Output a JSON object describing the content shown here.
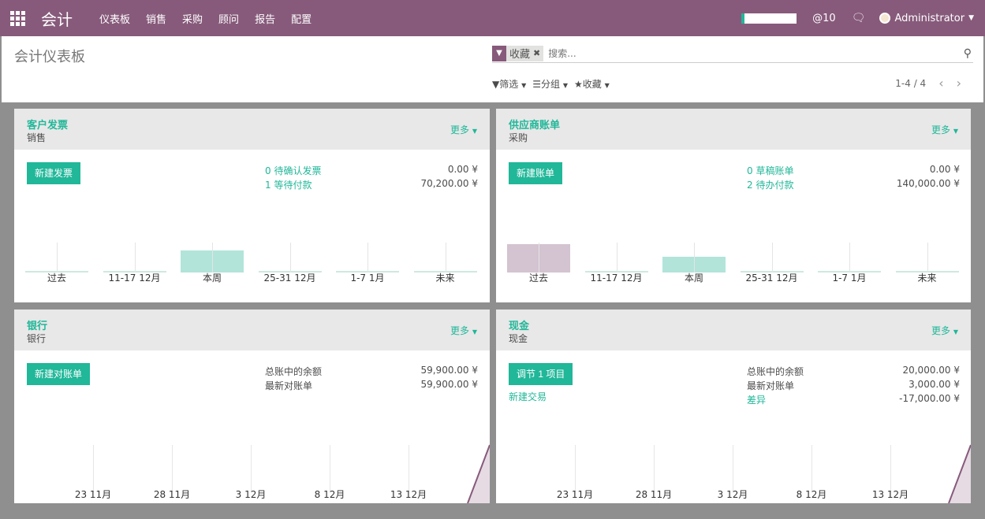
{
  "navbar": {
    "brand": "会计",
    "menu": [
      "仪表板",
      "销售",
      "采购",
      "顾问",
      "报告",
      "配置"
    ],
    "mentions": "@10",
    "user": "Administrator"
  },
  "control": {
    "title": "会计仪表板",
    "facet": "收藏",
    "search_placeholder": "搜索...",
    "filter_label": "筛选",
    "group_label": "分组",
    "fav_label": "收藏",
    "pager": "1-4 / 4"
  },
  "cards": {
    "sales": {
      "title": "客户发票",
      "subtitle": "销售",
      "more": "更多",
      "button": "新建发票",
      "stats": [
        {
          "label": "0 待确认发票",
          "value": "0.00 ¥"
        },
        {
          "label": "1 等待付款",
          "value": "70,200.00 ¥"
        }
      ],
      "bar_labels": [
        "过去",
        "11-17 12月",
        "本周",
        "25-31 12月",
        "1-7 1月",
        "未来"
      ],
      "bar_values": [
        0,
        0,
        70200,
        0,
        0,
        0
      ]
    },
    "purchase": {
      "title": "供应商账单",
      "subtitle": "采购",
      "more": "更多",
      "button": "新建账单",
      "stats": [
        {
          "label": "0 草稿账单",
          "value": "0.00 ¥"
        },
        {
          "label": "2 待办付款",
          "value": "140,000.00 ¥"
        }
      ],
      "bar_labels": [
        "过去",
        "11-17 12月",
        "本周",
        "25-31 12月",
        "1-7 1月",
        "未来"
      ],
      "bar_values": [
        90000,
        0,
        50000,
        0,
        0,
        0
      ]
    },
    "bank": {
      "title": "银行",
      "subtitle": "银行",
      "more": "更多",
      "button": "新建对账单",
      "stats": [
        {
          "label": "总账中的余额",
          "value": "59,900.00 ¥"
        },
        {
          "label": "最新对账单",
          "value": "59,900.00 ¥"
        }
      ],
      "line_labels": [
        "23 11月",
        "28 11月",
        "3 12月",
        "8 12月",
        "13 12月"
      ]
    },
    "cash": {
      "title": "现金",
      "subtitle": "现金",
      "more": "更多",
      "button": "调节 1 项目",
      "link": "新建交易",
      "stats": [
        {
          "label": "总账中的余额",
          "value": "20,000.00 ¥"
        },
        {
          "label": "最新对账单",
          "value": "3,000.00 ¥"
        },
        {
          "label": "差异",
          "value": "-17,000.00 ¥"
        }
      ],
      "line_labels": [
        "23 11月",
        "28 11月",
        "3 12月",
        "8 12月",
        "13 12月"
      ]
    }
  },
  "colors": {
    "brand": "#875a7b",
    "accent": "#21b799",
    "bar_current": "#b2e4da",
    "bar_past_purchase": "#d4c3d0"
  }
}
